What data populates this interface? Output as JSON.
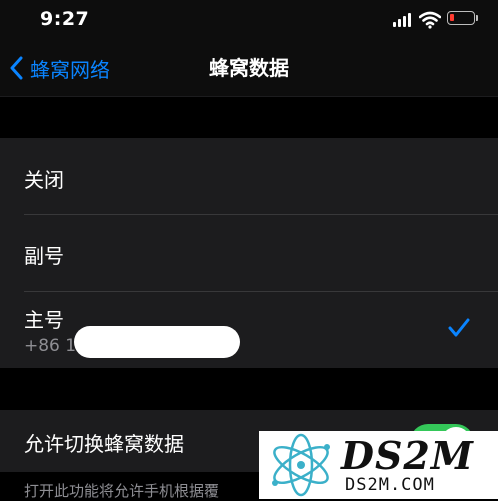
{
  "status_bar": {
    "time": "9:27",
    "icons": [
      "cellular-signal-icon",
      "wifi-icon",
      "battery-low-icon"
    ],
    "battery_color": "#ff3b30"
  },
  "nav": {
    "back_label": "蜂窝网络",
    "title": "蜂窝数据",
    "accent_color": "#0a84ff"
  },
  "options": [
    {
      "label": "关闭",
      "selected": false
    },
    {
      "label": "副号",
      "selected": false
    },
    {
      "label": "主号",
      "subtitle": "+86 1",
      "selected": true
    }
  ],
  "switch_row": {
    "label": "允许切换蜂窝数据",
    "on": true,
    "on_color": "#34c759"
  },
  "footer_note": "打开此功能将允许手机根据覆",
  "watermark": {
    "brand": "DS2M",
    "domain": "DS2M.COM"
  }
}
